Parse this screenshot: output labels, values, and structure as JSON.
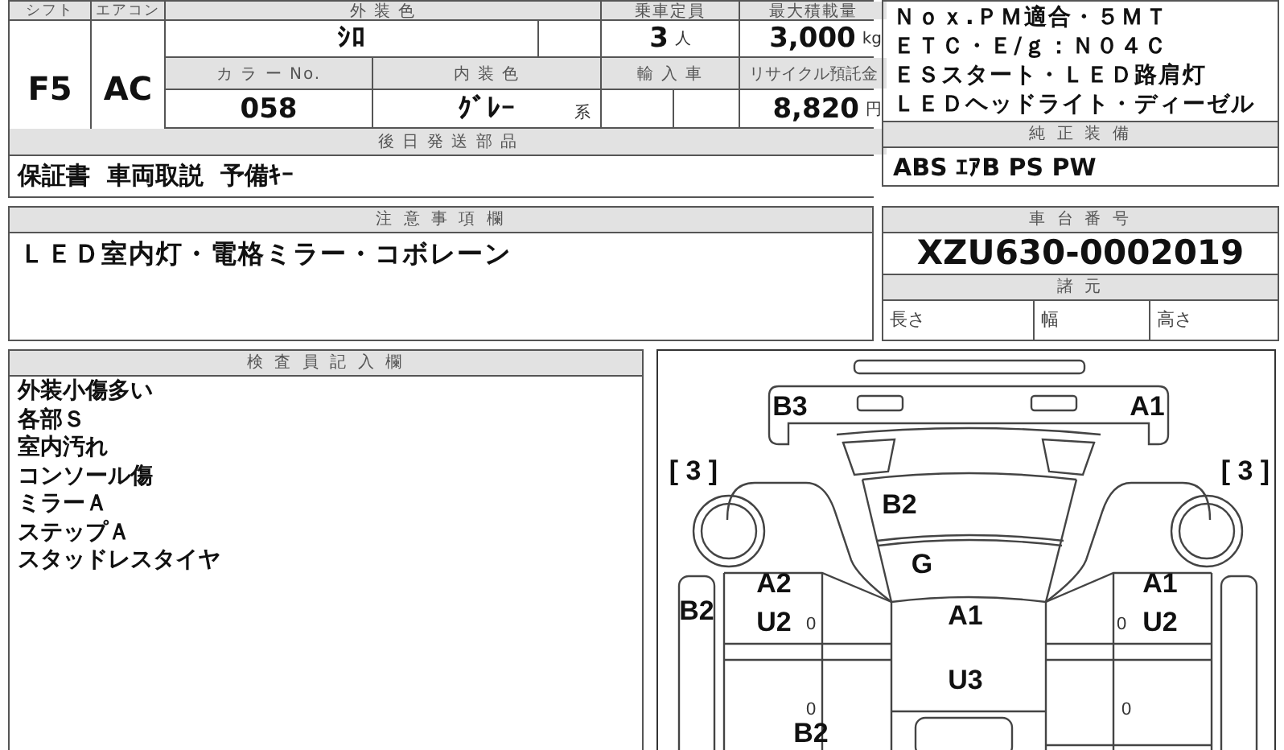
{
  "header": {
    "shift_label": "シフト",
    "aircon_label": "エアコン",
    "exterior_color_label": "外 装 色",
    "capacity_label": "乗車定員",
    "max_load_label": "最大積載量"
  },
  "vehicle": {
    "shift": "F5",
    "aircon": "AC",
    "exterior_color": "ｼﾛ",
    "capacity": "3",
    "capacity_unit": "人",
    "max_load": "3,000",
    "max_load_unit": "kg",
    "color_no_label": "カ ラ ー No.",
    "interior_color_label": "内 装 色",
    "import_label": "輸 入 車",
    "recycle_label": "リサイクル預託金",
    "color_no": "058",
    "interior_color": "ｸﾞﾚｰ",
    "interior_suffix": "系",
    "recycle_fee": "8,820",
    "recycle_unit": "円"
  },
  "later_parts": {
    "title": "後 日 発 送 部 品",
    "text": "保証書  車両取説  予備ｷｰ"
  },
  "features": {
    "lines": [
      "Ｎｏｘ.ＰＭ適合・５ＭＴ",
      "ＥＴＣ・Ｅ/ｇ：Ｎ０４Ｃ",
      "ＥＳスタート・ＬＥＤ路肩灯",
      "ＬＥＤヘッドライト・ディーゼル"
    ],
    "title": "純 正 装 備",
    "text": "ABS ｴｱB PS PW"
  },
  "notes": {
    "title": "注 意 事 項 欄",
    "text": "ＬＥＤ室内灯・電格ミラー・コボレーン"
  },
  "chassis": {
    "title": "車 台 番 号",
    "number": "XZU630-0002019",
    "spec_title": "諸 元",
    "spec_labels": [
      "長さ",
      "幅",
      "高さ"
    ]
  },
  "inspector": {
    "title": "検 査 員 記 入 欄",
    "lines": [
      "外装小傷多い",
      "各部Ｓ",
      "室内汚れ",
      "コンソール傷",
      "ミラーＡ",
      "ステップＡ",
      "スタッドレスタイヤ"
    ]
  },
  "diagram": {
    "marks": [
      {
        "text": "B3",
        "kind": "code"
      },
      {
        "text": "A1",
        "kind": "code"
      },
      {
        "text": "[ 3 ]",
        "kind": "code"
      },
      {
        "text": "[ 3 ]",
        "kind": "code"
      },
      {
        "text": "B2",
        "kind": "code"
      },
      {
        "text": "G",
        "kind": "code"
      },
      {
        "text": "A2",
        "kind": "code"
      },
      {
        "text": "A1",
        "kind": "code"
      },
      {
        "text": "B2",
        "kind": "code"
      },
      {
        "text": "U2",
        "kind": "code"
      },
      {
        "text": "0",
        "kind": "small"
      },
      {
        "text": "A1",
        "kind": "code"
      },
      {
        "text": "0",
        "kind": "small"
      },
      {
        "text": "U2",
        "kind": "code"
      },
      {
        "text": "U3",
        "kind": "code"
      },
      {
        "text": "0",
        "kind": "small"
      },
      {
        "text": "0",
        "kind": "small"
      },
      {
        "text": "B2",
        "kind": "code"
      }
    ]
  }
}
